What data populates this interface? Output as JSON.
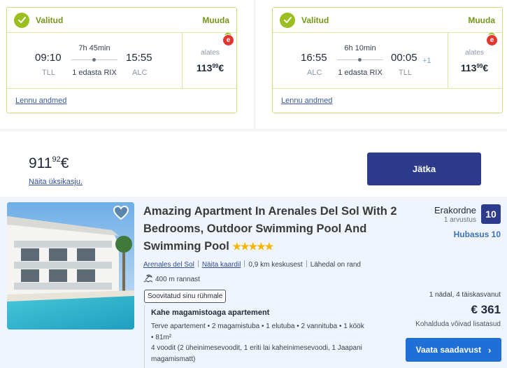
{
  "outbound": {
    "status": "Valitud",
    "change": "Muuda",
    "depart_time": "09:10",
    "depart_code": "TLL",
    "duration": "7h 45min",
    "stops": "1 edasta RIX",
    "arrive_time": "15:55",
    "arrive_code": "ALC",
    "from_label": "alates",
    "price_main": "113",
    "price_cents": "99",
    "price_currency": "€",
    "details_link": "Lennu andmed"
  },
  "inbound": {
    "status": "Valitud",
    "change": "Muuda",
    "depart_time": "16:55",
    "depart_code": "ALC",
    "duration": "6h 10min",
    "stops": "1 edasta RIX",
    "arrive_time": "00:05",
    "day_offset": "+1",
    "arrive_code": "TLL",
    "from_label": "alates",
    "price_main": "113",
    "price_cents": "99",
    "price_currency": "€",
    "details_link": "Lennu andmed"
  },
  "total": {
    "price_main": "911",
    "price_cents": "92",
    "currency": "€",
    "breakdown_link": "Näita üksikasju.",
    "continue_button": "Jätka"
  },
  "hotel": {
    "title": "Amazing Apartment In Arenales Del Sol With 2 Bedrooms, Outdoor Swimming Pool And Swimming Pool",
    "stars": "★★★★★",
    "location_link": "Arenales del Sol",
    "map_link": "Näita kaardil",
    "distance_center": "0,9 km keskusest",
    "nearby": "Lähedal on rand",
    "beach_distance": "400 m rannast",
    "recommended_tag": "Soovitatud sinu rühmale",
    "room_title": "Kahe magamistoaga apartement",
    "room_desc": "Terve apartement • 2 magamistuba • 1 elutuba • 2 vannituba • 1 köök • 81m²",
    "beds": "4 voodit (2 üheinimesevoodit, 1 eriti lai kaheinimesevoodi, 1 Jaapani magamismatt)",
    "rating_word": "Erakordne",
    "review_count": "1 arvustus",
    "rating_score": "10",
    "value_score": "Hubasus 10",
    "stay_info": "1 nädal, 4 täiskasvanut",
    "price": "€ 361",
    "fees_note": "Kohalduda võivad lisatasud",
    "cta": "Vaata saadavust",
    "cta_chevron": "›"
  },
  "icons": {
    "check": "check-icon",
    "heart": "heart-icon",
    "beach": "beach-icon",
    "eco": "e-icon"
  },
  "colors": {
    "accent_green": "#9bbf21",
    "primary_navy": "#2d3b8d",
    "cta_blue": "#1f6fd6",
    "star_gold": "#f4b400"
  }
}
